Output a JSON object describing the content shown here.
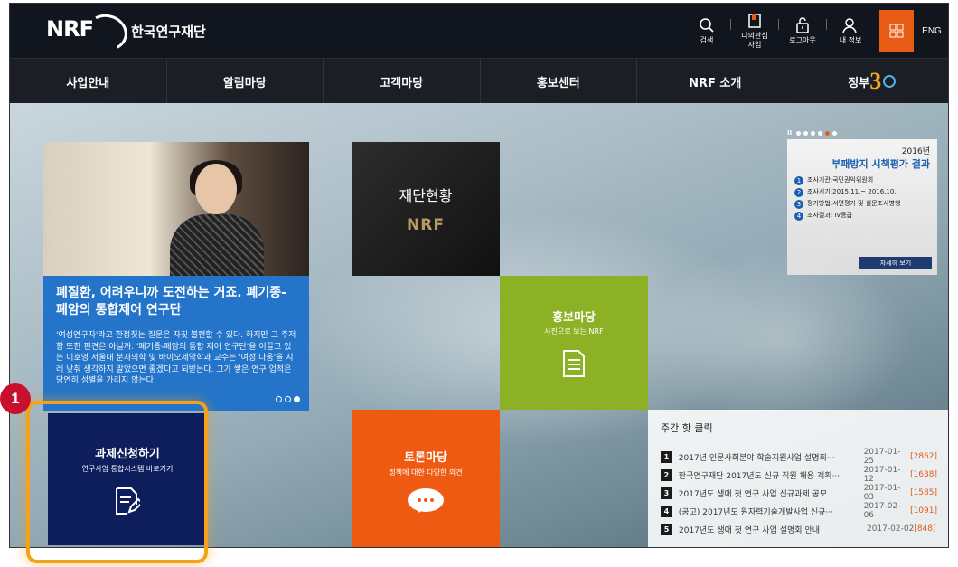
{
  "header": {
    "logo": "NRF",
    "org_name": "한국연구재단",
    "util": {
      "search": "검색",
      "my_biz_line1": "나의관심",
      "my_biz_line2": "사업",
      "logout": "로그아웃",
      "my_info": "내 정보",
      "eng": "ENG"
    }
  },
  "nav": {
    "items": [
      "사업안내",
      "알림마당",
      "고객마당",
      "홍보센터",
      "NRF 소개"
    ],
    "gov_prefix": "정부",
    "gov_num": "3"
  },
  "feature": {
    "title": "폐질환, 어려우니까 도전하는 거죠. 폐기종-폐암의 통합제어 연구단",
    "body": "'여성연구자'라고 한정짓는 질문은 자칫 불편할 수 있다. 하지만 그 주저함 또한 편견은 아닐까. '폐기종-폐암의 통합 제어 연구단'을 이끌고 있는 이호영 서울대 분자의학 및 바이오제약학과 교수는 '여성 다움'을 지레 낮춰 생각하지 말았으면 좋겠다고 되받는다. 그가 쌓은 연구 업적은 당연히 성별을 가리지 않는다."
  },
  "tiles": {
    "foundation_title": "재단현황",
    "foundation_logo": "NRF",
    "pr_title": "홍보마당",
    "pr_sub": "사진으로 보는 NRF",
    "discuss_title": "토론마당",
    "discuss_sub": "정책에 대한 다양한 의견",
    "apply_title": "과제신청하기",
    "apply_sub": "연구사업 통합시스템 바로가기"
  },
  "callout": {
    "number": "1"
  },
  "evaluation": {
    "year": "2016년",
    "title": "부패방지 시책평가 결과",
    "rows": [
      {
        "n": "1",
        "text": "조사기관:국민권익위원회"
      },
      {
        "n": "2",
        "text": "조사시기:2015.11.~ 2016.10."
      },
      {
        "n": "3",
        "text": "평가방법:서면평가 및 설문조사병행"
      },
      {
        "n": "4",
        "text": "조사결과: IV등급"
      }
    ],
    "more": "자세히 보기"
  },
  "hot_clicks": {
    "title": "주간 핫 클릭",
    "items": [
      {
        "num": "1",
        "text": "2017년 인문사회분야 학술지원사업 설명회···",
        "date": "2017-01-25",
        "count": "[2862]"
      },
      {
        "num": "2",
        "text": "한국연구재단 2017년도 신규 직원 채용 계획···",
        "date": "2017-01-12",
        "count": "[1638]"
      },
      {
        "num": "3",
        "text": "2017년도 생애 첫 연구 사업 신규과제 공모",
        "date": "2017-01-03",
        "count": "[1585]"
      },
      {
        "num": "4",
        "text": "(공고) 2017년도 원자력기술개발사업 신규···",
        "date": "2017-02-06",
        "count": "[1091]"
      },
      {
        "num": "5",
        "text": "2017년도 생애 첫 연구 사업 설명회 안내",
        "date": "2017-02-02",
        "count": "[848]"
      }
    ]
  },
  "colors": {
    "accent_orange": "#e85c15",
    "feature_blue": "#2474c9",
    "pr_green": "#8db125",
    "apply_navy": "#0e1e5c",
    "highlight": "#f5a21b",
    "badge_red": "#c8102e"
  }
}
